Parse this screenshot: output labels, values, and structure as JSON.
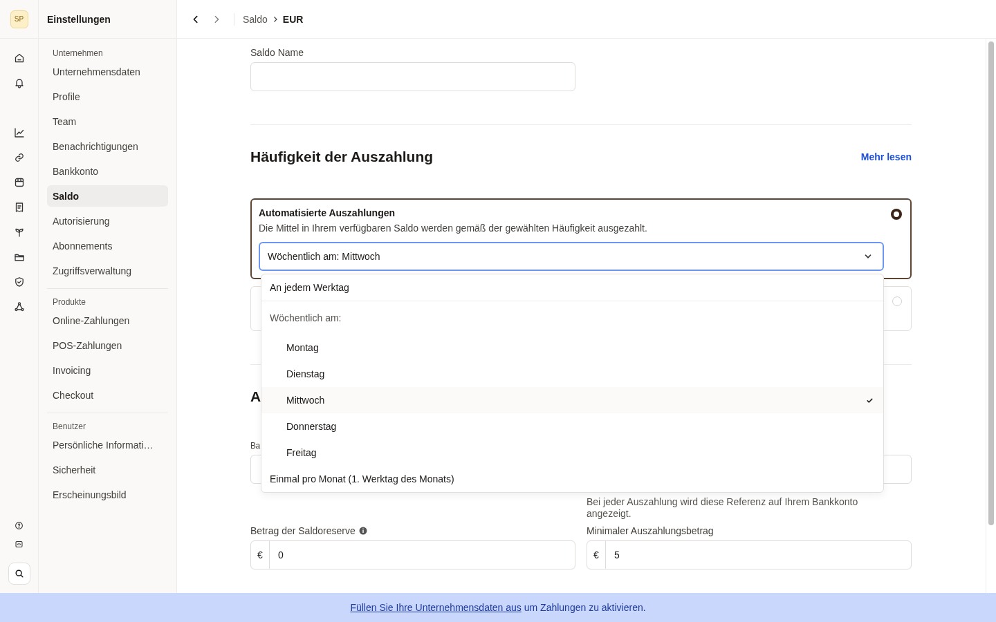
{
  "rail": {
    "avatar": "SP"
  },
  "sidebar": {
    "title": "Einstellungen",
    "groups": [
      {
        "heading": "Unternehmen",
        "items": [
          {
            "label": "Unternehmensdaten",
            "selected": false
          },
          {
            "label": "Profile",
            "selected": false
          },
          {
            "label": "Team",
            "selected": false
          },
          {
            "label": "Benachrichtigungen",
            "selected": false
          },
          {
            "label": "Bankkonto",
            "selected": false
          },
          {
            "label": "Saldo",
            "selected": true
          },
          {
            "label": "Autorisierung",
            "selected": false
          },
          {
            "label": "Abonnements",
            "selected": false
          },
          {
            "label": "Zugriffsverwaltung",
            "selected": false
          }
        ]
      },
      {
        "heading": "Produkte",
        "items": [
          {
            "label": "Online-Zahlungen",
            "selected": false
          },
          {
            "label": "POS-Zahlungen",
            "selected": false
          },
          {
            "label": "Invoicing",
            "selected": false
          },
          {
            "label": "Checkout",
            "selected": false
          }
        ]
      },
      {
        "heading": "Benutzer",
        "items": [
          {
            "label": "Persönliche Informati…",
            "selected": false
          },
          {
            "label": "Sicherheit",
            "selected": false
          },
          {
            "label": "Erscheinungsbild",
            "selected": false
          }
        ]
      }
    ]
  },
  "breadcrumb": [
    "Saldo",
    "EUR"
  ],
  "name_field": {
    "label": "Saldo Name"
  },
  "payout": {
    "title": "Häufigkeit der Auszahlung",
    "link": "Mehr lesen",
    "cards": [
      {
        "title": "Automatisierte Auszahlungen",
        "description": "Die Mittel in Ihrem verfügbaren Saldo werden gemäß der gewählten Häufigkeit ausgezahlt.",
        "selected": true,
        "select_value": "Wöchentlich am: Mittwoch"
      },
      {
        "selected": false
      }
    ]
  },
  "dropdown": [
    {
      "kind": "option",
      "label": "An jedem Werktag",
      "selected": false
    },
    {
      "kind": "group",
      "label": "Wöchentlich am:",
      "children": [
        {
          "label": "Montag",
          "selected": false
        },
        {
          "label": "Dienstag",
          "selected": false
        },
        {
          "label": "Mittwoch",
          "selected": true
        },
        {
          "label": "Donnerstag",
          "selected": false
        },
        {
          "label": "Freitag",
          "selected": false
        }
      ]
    },
    {
      "kind": "option",
      "label": "Einmal pro Monat (1. Werktag des Monats)",
      "selected": false
    }
  ],
  "section2": {
    "title": "A",
    "field_label": "Ba",
    "hint": "Bei jeder Auszahlung wird diese Referenz auf Ihrem Bankkonto angezeigt."
  },
  "amounts": [
    {
      "label": "Betrag der Saldoreserve",
      "info": true,
      "currency": "€",
      "value": "0"
    },
    {
      "label": "Minimaler Auszahlungsbetrag",
      "info": false,
      "currency": "€",
      "value": "5"
    }
  ],
  "banner": {
    "link": "Füllen Sie Ihre Unternehmensdaten aus",
    "text": "um Zahlungen zu aktivieren."
  }
}
